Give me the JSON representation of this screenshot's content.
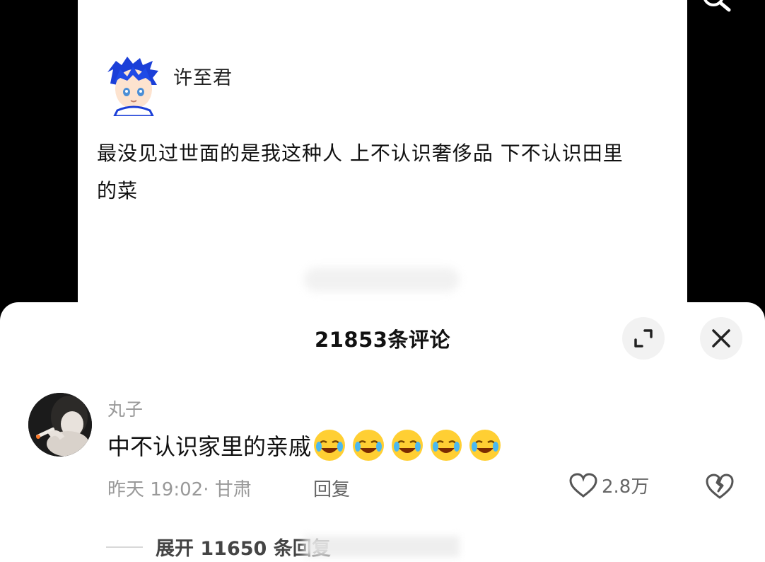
{
  "post": {
    "author": "许至君",
    "text": "最没见过世面的是我这种人 上不认识奢侈品 下不认识田里的菜"
  },
  "comments_panel": {
    "title": "21853条评论",
    "expand_icon": "expand-icon",
    "close_icon": "close-icon"
  },
  "comment": {
    "username": "丸子",
    "text": "中不认识家里的亲戚",
    "emoji": "laughing-crying-emoji",
    "emoji_count": 5,
    "meta": "昨天 19:02· 甘肃",
    "reply_label": "回复",
    "like_count": "2.8万",
    "expand_replies": "展开 11650 条回复"
  },
  "colors": {
    "background": "#000000",
    "card": "#ffffff",
    "muted_text": "#999999",
    "primary_text": "#111111"
  }
}
